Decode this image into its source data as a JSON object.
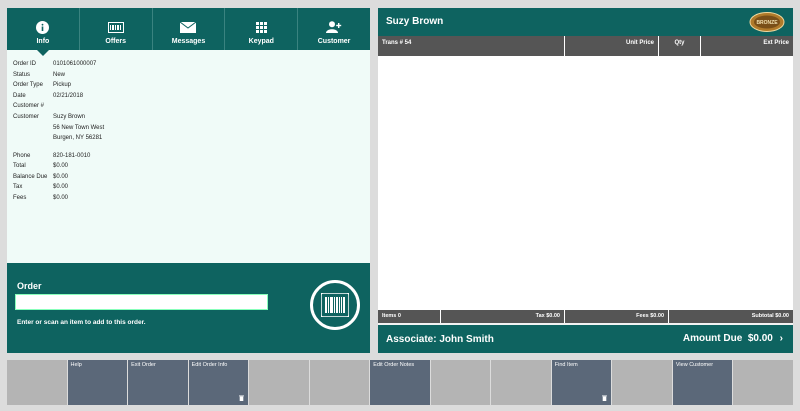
{
  "tabs": [
    {
      "label": "Info",
      "icon": "info-icon",
      "active": true
    },
    {
      "label": "Offers",
      "icon": "offers-icon",
      "active": false
    },
    {
      "label": "Messages",
      "icon": "envelope-icon",
      "active": false
    },
    {
      "label": "Keypad",
      "icon": "keypad-icon",
      "active": false
    },
    {
      "label": "Customer",
      "icon": "add-customer-icon",
      "active": false
    }
  ],
  "details": {
    "order_id": {
      "k": "Order ID",
      "v": "0101061000007"
    },
    "status": {
      "k": "Status",
      "v": "New"
    },
    "order_type": {
      "k": "Order Type",
      "v": "Pickup"
    },
    "date": {
      "k": "Date",
      "v": "02/21/2018"
    },
    "customer_num": {
      "k": "Customer #",
      "v": ""
    },
    "customer": {
      "k": "Customer",
      "v": "Suzy Brown"
    },
    "addr1": "56 New Town West",
    "addr2": "Burgen, NY 56281",
    "phone": {
      "k": "Phone",
      "v": "820-181-0010"
    },
    "total": {
      "k": "Total",
      "v": "$0.00"
    },
    "balance_due": {
      "k": "Balance Due",
      "v": "$0.00"
    },
    "tax": {
      "k": "Tax",
      "v": "$0.00"
    },
    "fees": {
      "k": "Fees",
      "v": "$0.00"
    }
  },
  "order": {
    "title": "Order",
    "input_value": "",
    "hint": "Enter or scan an item to add to this order."
  },
  "right": {
    "customer_name": "Suzy Brown",
    "badge": "BRONZE",
    "columns": [
      "Trans # 54",
      "Unit Price",
      "Qty",
      "Ext Price"
    ],
    "footer": {
      "items": "Items 0",
      "tax": "Tax $0.00",
      "fees": "Fees $0.00",
      "subtotal": "Subtotal $0.00"
    },
    "associate": "Associate: John Smith",
    "amount_due": "Amount Due  $0.00",
    "amount_chevron": "›"
  },
  "fkeys": [
    {
      "label": "",
      "enabled": false,
      "trash": false
    },
    {
      "label": "Help",
      "enabled": true,
      "trash": false
    },
    {
      "label": "Exit Order",
      "enabled": true,
      "trash": false
    },
    {
      "label": "Edit Order Info",
      "enabled": true,
      "trash": true
    },
    {
      "label": "",
      "enabled": false,
      "trash": false
    },
    {
      "label": "",
      "enabled": false,
      "trash": false
    },
    {
      "label": "Edit Order Notes",
      "enabled": true,
      "trash": false
    },
    {
      "label": "",
      "enabled": false,
      "trash": false
    },
    {
      "label": "",
      "enabled": false,
      "trash": false
    },
    {
      "label": "Find Item",
      "enabled": true,
      "trash": true
    },
    {
      "label": "",
      "enabled": false,
      "trash": false
    },
    {
      "label": "View Customer",
      "enabled": true,
      "trash": false
    },
    {
      "label": "",
      "enabled": false,
      "trash": false
    }
  ],
  "colors": {
    "teal": "#0e6360",
    "fkey": "#5b6879",
    "disabled": "#b4b4b4"
  }
}
